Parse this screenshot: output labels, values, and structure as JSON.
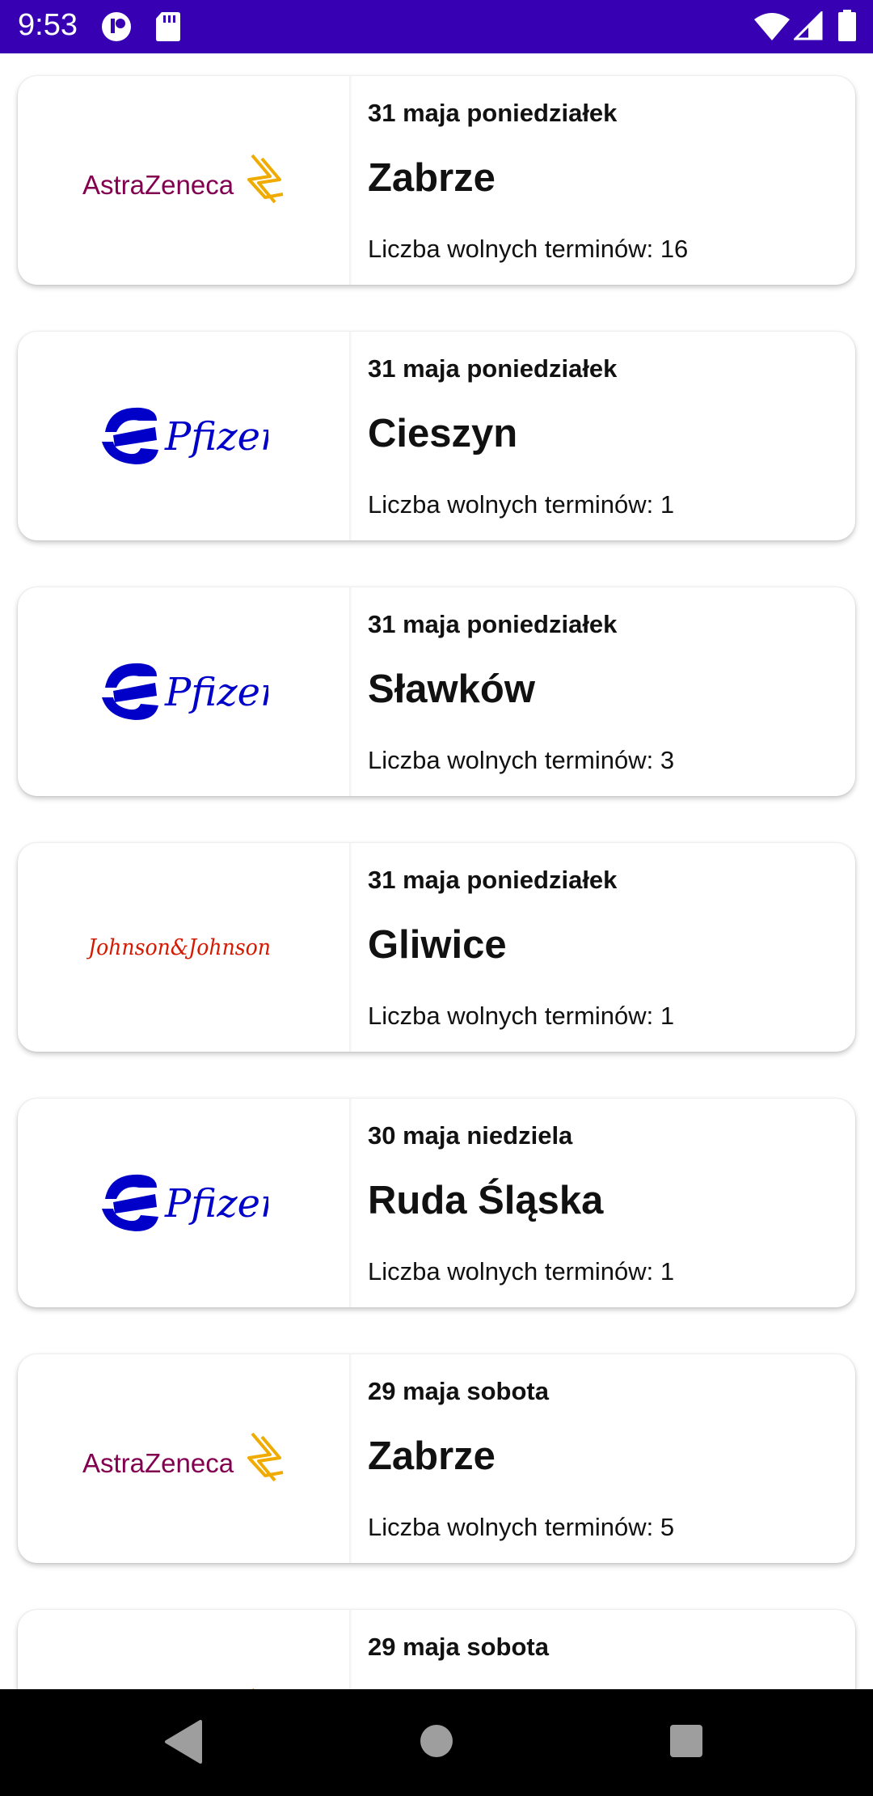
{
  "status_bar": {
    "time": "9:53",
    "left_icons": [
      "notification-app-icon",
      "sd-card-icon"
    ],
    "right_icons": [
      "wifi-icon",
      "signal-icon",
      "battery-icon"
    ],
    "background": "#3700b3"
  },
  "brands": {
    "astrazeneca": {
      "text": "AstraZeneca",
      "text_color": "#830051",
      "mark_color": "#f0ab00"
    },
    "pfizer": {
      "text": "Pfizer",
      "color": "#0000c9"
    },
    "jnj": {
      "text": "Johnson&Johnson",
      "color": "#d51900"
    }
  },
  "cards": [
    {
      "logo": "astrazeneca",
      "date": "31 maja poniedziałek",
      "city": "Zabrze",
      "slots": "Liczba wolnych terminów: 16"
    },
    {
      "logo": "pfizer",
      "date": "31 maja poniedziałek",
      "city": "Cieszyn",
      "slots": "Liczba wolnych terminów: 1"
    },
    {
      "logo": "pfizer",
      "date": "31 maja poniedziałek",
      "city": "Sławków",
      "slots": "Liczba wolnych terminów: 3"
    },
    {
      "logo": "jnj",
      "date": "31 maja poniedziałek",
      "city": "Gliwice",
      "slots": "Liczba wolnych terminów: 1"
    },
    {
      "logo": "pfizer",
      "date": "30 maja niedziela",
      "city": "Ruda Śląska",
      "slots": "Liczba wolnych terminów: 1"
    },
    {
      "logo": "astrazeneca",
      "date": "29 maja sobota",
      "city": "Zabrze",
      "slots": "Liczba wolnych terminów: 5"
    },
    {
      "logo": "astrazeneca",
      "date": "29 maja sobota",
      "city": "",
      "slots": ""
    }
  ],
  "nav_bar": {
    "buttons": [
      "back-icon",
      "home-icon",
      "recents-icon"
    ]
  }
}
